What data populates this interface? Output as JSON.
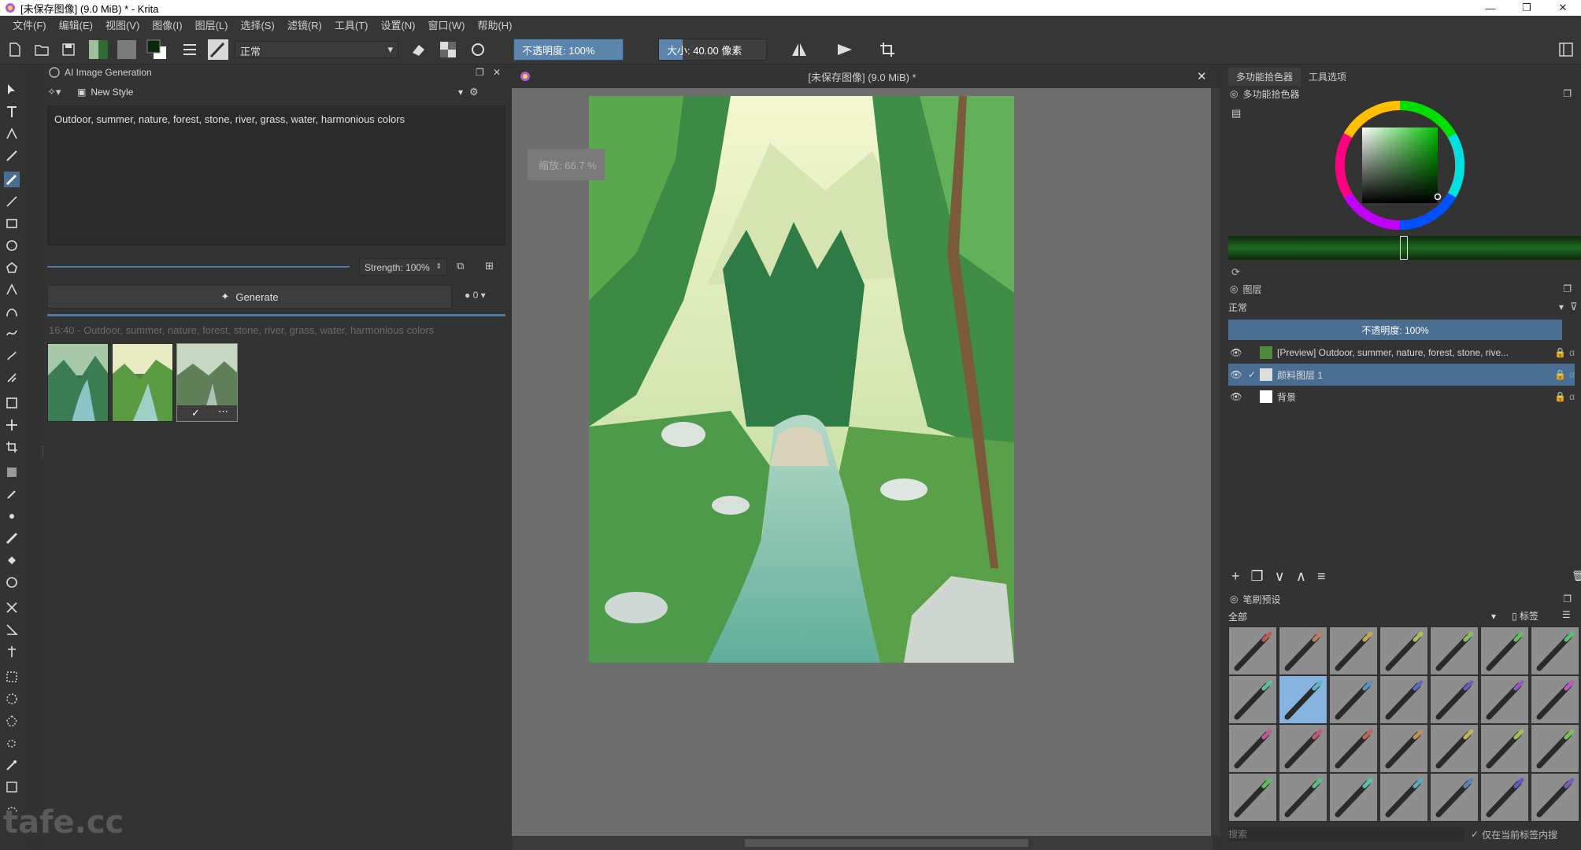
{
  "window": {
    "title": "[未保存图像]  (9.0 MiB) * - Krita",
    "min_glyph": "—",
    "max_glyph": "❐",
    "close_glyph": "✕"
  },
  "menu": [
    "文件(F)",
    "编辑(E)",
    "视图(V)",
    "图像(I)",
    "图层(L)",
    "选择(S)",
    "滤镜(R)",
    "工具(T)",
    "设置(N)",
    "窗口(W)",
    "帮助(H)"
  ],
  "toolbar": {
    "blend_mode": "正常",
    "opacity_label": "不透明度:  100%",
    "opacity_fraction": 1.0,
    "size_label": "大小:  40.00 像素",
    "size_fraction": 0.22
  },
  "ai_docker": {
    "title": "AI Image Generation",
    "style": "New Style",
    "prompt": "Outdoor, summer, nature, forest, stone, river, grass, water, harmonious colors",
    "strength_label": "Strength: 100%",
    "strength_fraction": 1.0,
    "generate_label": "Generate",
    "queue_count": "0",
    "history_label": "16:40 - Outdoor, summer, nature, forest, stone, river, grass, water, harmonious colors"
  },
  "canvas": {
    "tab_title": "[未保存图像]  (9.0 MiB) *",
    "zoom_label": "缩放: 66.7 %"
  },
  "right": {
    "tabs": [
      "多功能拾色器",
      "工具选项"
    ],
    "color_selector_title": "多功能拾色器",
    "layers_title": "图层",
    "layer_blend": "正常",
    "layer_opacity_label": "不透明度:  100%",
    "layers": [
      {
        "name": "[Preview] Outdoor, summer, nature, forest, stone, rive...",
        "active": false,
        "checked": false
      },
      {
        "name": "颜料图层 1",
        "active": true,
        "checked": true
      },
      {
        "name": "背景",
        "active": false,
        "checked": false
      }
    ],
    "brushes_title": "笔刷预设",
    "brush_filter": "全部",
    "brush_tag": "标签",
    "brush_search_placeholder": "搜索",
    "brush_only_current_tag": "仅在当前标签内搜"
  },
  "watermark": "tafe.cc",
  "colors": {
    "accent": "#4a6e92",
    "panel": "#333333",
    "canvas_bg": "#6e6e6e",
    "active_layer": "#4a6e92"
  }
}
